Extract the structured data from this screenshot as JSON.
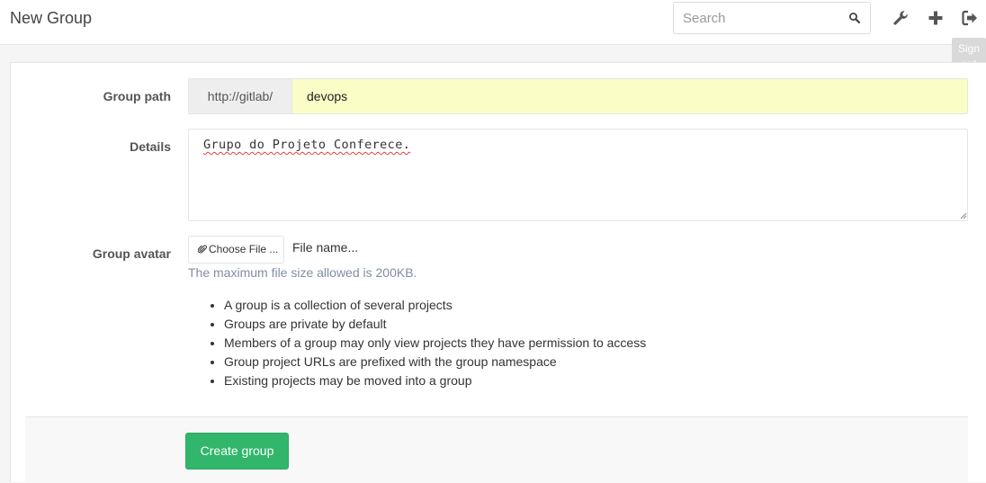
{
  "header": {
    "title": "New Group",
    "search_placeholder": "Search",
    "icons": [
      "admin-wrench-icon",
      "new-plus-icon",
      "sign-out-icon"
    ],
    "tooltip": "Sign out"
  },
  "form": {
    "group_path": {
      "label": "Group path",
      "prefix": "http://gitlab/",
      "value": "devops"
    },
    "details": {
      "label": "Details",
      "value": "Grupo do Projeto Conferece."
    },
    "avatar": {
      "label": "Group avatar",
      "button_label": "Choose File ...",
      "file_name": "File name...",
      "help": "The maximum file size allowed is 200KB."
    },
    "info_items": [
      "A group is a collection of several projects",
      "Groups are private by default",
      "Members of a group may only view projects they have permission to access",
      "Group project URLs are prefixed with the group namespace",
      "Existing projects may be moved into a group"
    ],
    "submit_label": "Create group"
  },
  "colors": {
    "accent_green": "#31b66b",
    "path_input_bg": "#fafdc6",
    "help_text": "#7f8fa4"
  }
}
